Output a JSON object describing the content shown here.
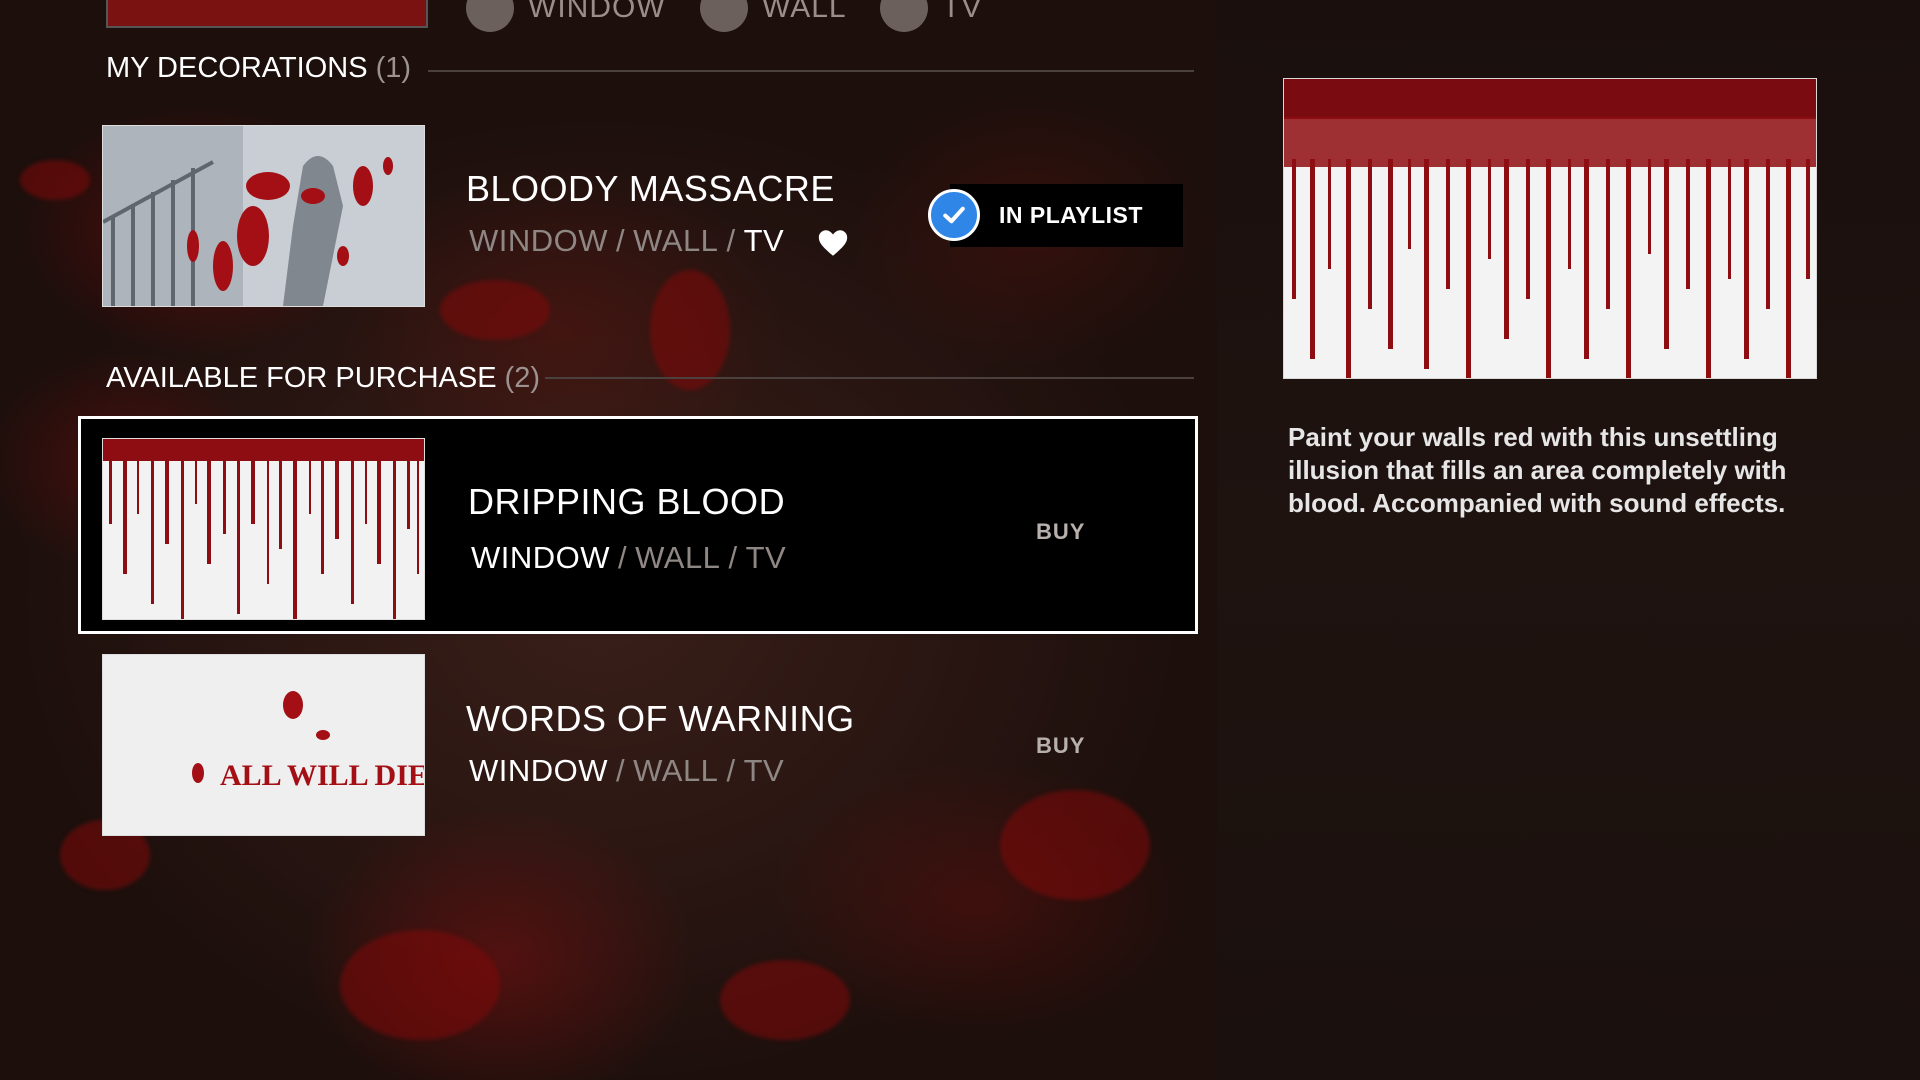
{
  "top_row": {
    "tags": [
      "WINDOW",
      "WALL",
      "TV"
    ]
  },
  "sections": {
    "my_decorations": {
      "label": "MY DECORATIONS",
      "count": "(1)"
    },
    "available": {
      "label": "AVAILABLE FOR PURCHASE",
      "count": "(2)"
    }
  },
  "my_items": [
    {
      "title": "BLOODY MASSACRE",
      "surfaces": [
        "WINDOW",
        "WALL",
        "TV"
      ],
      "separator": "/",
      "playlist_label": "IN PLAYLIST",
      "thumb_icon": "bloody-massacre-thumbnail"
    }
  ],
  "purchase_items": [
    {
      "title": "DRIPPING BLOOD",
      "surfaces": [
        "WINDOW",
        "WALL",
        "TV"
      ],
      "buy_label": "BUY",
      "selected": true
    },
    {
      "title": "WORDS OF WARNING",
      "surfaces": [
        "WINDOW",
        "WALL",
        "TV"
      ],
      "buy_label": "BUY",
      "thumb_text": "ALL WILL DIE"
    }
  ],
  "detail": {
    "description": "Paint your walls red with this unsettling illusion that fills an area completely with blood. Accompanied with sound effects."
  },
  "colors": {
    "accent_check": "#2f86e6",
    "blood": "#8a0e0e",
    "background": "#2a1612"
  }
}
